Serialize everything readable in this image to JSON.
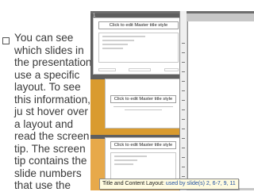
{
  "bullet_text": "You can see which slides in the presentation use a specific layout. To see this information, ju st hover over a layout and read the screen tip. The screen tip contains the slide numbers that use the",
  "screenshot": {
    "thumbnails": [
      {
        "number": "1",
        "title": "Click to edit Master title style"
      },
      {
        "number": "",
        "title": "Click to edit Master title style"
      },
      {
        "number": "",
        "title": "Click to edit Master title style"
      }
    ],
    "tooltip": {
      "layout_name": "Title and Content Layout:",
      "usage": "used by slide(s) 2, 6-7, 9, 11"
    }
  },
  "colors": {
    "highlight": "#e7a94a",
    "tooltip_bg": "#fffbe0"
  },
  "icons": [
    "bullet-square-icon"
  ]
}
